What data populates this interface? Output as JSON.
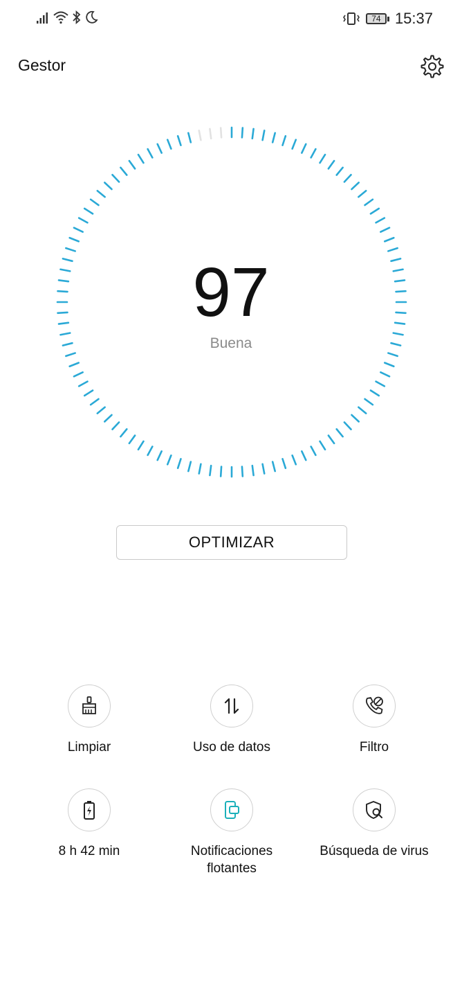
{
  "status_bar": {
    "time": "15:37",
    "battery_level": "74",
    "icons": [
      "signal-icon",
      "wifi-icon",
      "bluetooth-icon",
      "do-not-disturb-icon",
      "vibrate-icon",
      "battery-icon"
    ]
  },
  "header": {
    "title": "Gestor",
    "settings_icon": "gear-icon"
  },
  "score": {
    "value": "97",
    "label": "Buena",
    "gauge_fraction": 0.97,
    "accent_color": "#2aa9d6",
    "inactive_color": "#e2e2e2"
  },
  "optimize_button": {
    "label": "OPTIMIZAR"
  },
  "tools": [
    {
      "label": "Limpiar",
      "icon": "broom-icon"
    },
    {
      "label": "Uso de datos",
      "icon": "data-transfer-icon"
    },
    {
      "label": "Filtro",
      "icon": "call-block-icon"
    },
    {
      "label": "8 h 42 min",
      "icon": "battery-icon"
    },
    {
      "label": "Notificaciones flotantes",
      "icon": "floating-notification-icon"
    },
    {
      "label": "Búsqueda de virus",
      "icon": "virus-scan-icon"
    }
  ]
}
